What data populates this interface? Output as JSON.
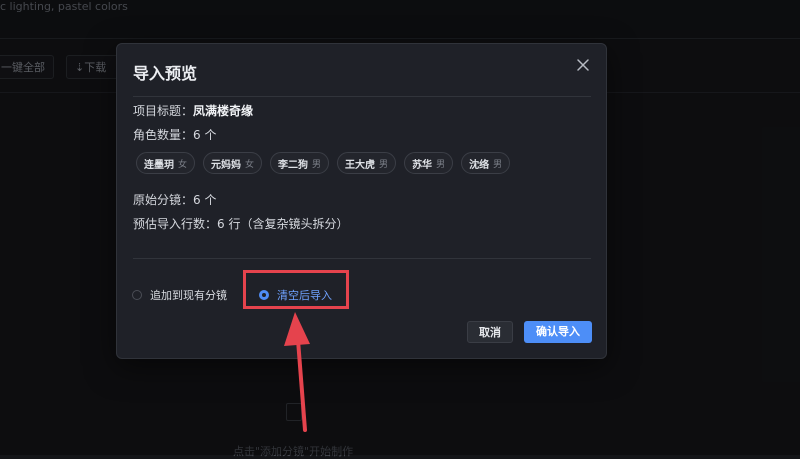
{
  "background": {
    "prompt_text": "c lighting, pastel colors",
    "toolbar_buttons": [
      "一键全部",
      "⇣下载"
    ],
    "empty_hint": "点击\"添加分镜\"开始制作"
  },
  "modal": {
    "title": "导入预览",
    "project_label": "项目标题：",
    "project_value": "凤满楼奇缘",
    "role_count_label": "角色数量：",
    "role_count_value": "6 个",
    "characters": [
      {
        "name": "连墨玥",
        "gender": "女"
      },
      {
        "name": "元妈妈",
        "gender": "女"
      },
      {
        "name": "李二狗",
        "gender": "男"
      },
      {
        "name": "王大虎",
        "gender": "男"
      },
      {
        "name": "苏华",
        "gender": "男"
      },
      {
        "name": "沈络",
        "gender": "男"
      }
    ],
    "shots_label": "原始分镜：",
    "shots_value": "6 个",
    "estimate_label": "预估导入行数：",
    "estimate_value": "6 行（含复杂镜头拆分）",
    "options": {
      "append": "追加到现有分镜",
      "replace": "清空后导入",
      "selected": "replace"
    },
    "cancel_label": "取消",
    "confirm_label": "确认导入"
  },
  "colors": {
    "accent": "#4d8ef7",
    "annotation": "#e5434d"
  }
}
